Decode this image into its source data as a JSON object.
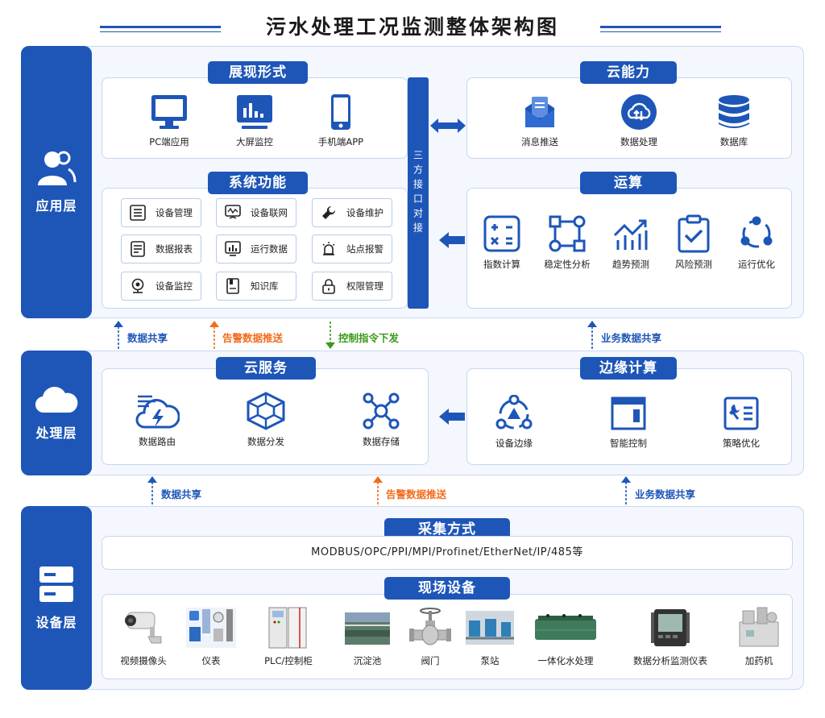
{
  "title": "污水处理工况监测整体架构图",
  "colors": {
    "primary": "#1e56b8",
    "orange": "#f26b1d",
    "green": "#3a9a1a"
  },
  "app_layer": {
    "label": "应用层",
    "icon": "users-icon",
    "display": {
      "tab": "展现形式",
      "items": [
        {
          "label": "PC端应用",
          "icon": "monitor-icon"
        },
        {
          "label": "大屏监控",
          "icon": "dashboard-screen-icon"
        },
        {
          "label": "手机端APP",
          "icon": "mobile-phone-icon"
        }
      ]
    },
    "functions": {
      "tab": "系统功能",
      "items": [
        {
          "label": "设备管理",
          "icon": "list-icon"
        },
        {
          "label": "设备联网",
          "icon": "network-icon"
        },
        {
          "label": "设备维护",
          "icon": "wrench-icon"
        },
        {
          "label": "数据报表",
          "icon": "report-icon"
        },
        {
          "label": "运行数据",
          "icon": "chart-screen-icon"
        },
        {
          "label": "站点报警",
          "icon": "alarm-icon"
        },
        {
          "label": "设备监控",
          "icon": "camera-icon"
        },
        {
          "label": "知识库",
          "icon": "book-icon"
        },
        {
          "label": "权限管理",
          "icon": "lock-icon"
        }
      ]
    },
    "interface_bar": "三方接口对接",
    "cloud_capability": {
      "tab": "云能力",
      "items": [
        {
          "label": "消息推送",
          "icon": "message-icon"
        },
        {
          "label": "数据处理",
          "icon": "cloud-process-icon"
        },
        {
          "label": "数据库",
          "icon": "database-icon"
        }
      ]
    },
    "computation": {
      "tab": "运算",
      "items": [
        {
          "label": "指数计算",
          "icon": "calculator-icon"
        },
        {
          "label": "稳定性分析",
          "icon": "nodes-square-icon"
        },
        {
          "label": "趋势预测",
          "icon": "trend-icon"
        },
        {
          "label": "风险预测",
          "icon": "clipboard-check-icon"
        },
        {
          "label": "运行优化",
          "icon": "cycle-icon"
        }
      ]
    }
  },
  "flows_top": [
    {
      "label": "数据共享",
      "direction": "up",
      "color": "blue"
    },
    {
      "label": "告警数据推送",
      "direction": "up",
      "color": "orange"
    },
    {
      "label": "控制指令下发",
      "direction": "down",
      "color": "green"
    },
    {
      "label": "业务数据共享",
      "direction": "up",
      "color": "blue"
    }
  ],
  "process_layer": {
    "label": "处理层",
    "icon": "cloud-icon",
    "cloud_service": {
      "tab": "云服务",
      "items": [
        {
          "label": "数据路由",
          "icon": "cloud-lightning-icon"
        },
        {
          "label": "数据分发",
          "icon": "hexagon-network-icon"
        },
        {
          "label": "数据存储",
          "icon": "molecule-icon"
        }
      ]
    },
    "edge_computing": {
      "tab": "边缘计算",
      "items": [
        {
          "label": "设备边缘",
          "icon": "edge-device-icon"
        },
        {
          "label": "智能控制",
          "icon": "window-control-icon"
        },
        {
          "label": "策略优化",
          "icon": "strategy-icon"
        }
      ]
    }
  },
  "flows_bottom": [
    {
      "label": "数据共享",
      "direction": "up",
      "color": "blue"
    },
    {
      "label": "告警数据推送",
      "direction": "up",
      "color": "orange"
    },
    {
      "label": "业务数据共享",
      "direction": "up",
      "color": "blue"
    }
  ],
  "device_layer": {
    "label": "设备层",
    "icon": "server-icon",
    "collection": {
      "tab": "采集方式",
      "protocols": "MODBUS/OPC/PPI/MPI/Profinet/EtherNet/IP/485等"
    },
    "field": {
      "tab": "现场设备",
      "items": [
        {
          "label": "视频摄像头",
          "icon": "cctv-camera-icon"
        },
        {
          "label": "仪表",
          "icon": "instruments-icon"
        },
        {
          "label": "PLC/控制柜",
          "icon": "control-cabinet-icon"
        },
        {
          "label": "沉淀池",
          "icon": "sedimentation-tank-icon"
        },
        {
          "label": "阀门",
          "icon": "valve-icon"
        },
        {
          "label": "泵站",
          "icon": "pump-station-icon"
        },
        {
          "label": "一体化水处理",
          "icon": "water-treatment-unit-icon"
        },
        {
          "label": "数据分析监测仪表",
          "icon": "power-meter-icon"
        },
        {
          "label": "加药机",
          "icon": "dosing-machine-icon"
        }
      ]
    }
  }
}
